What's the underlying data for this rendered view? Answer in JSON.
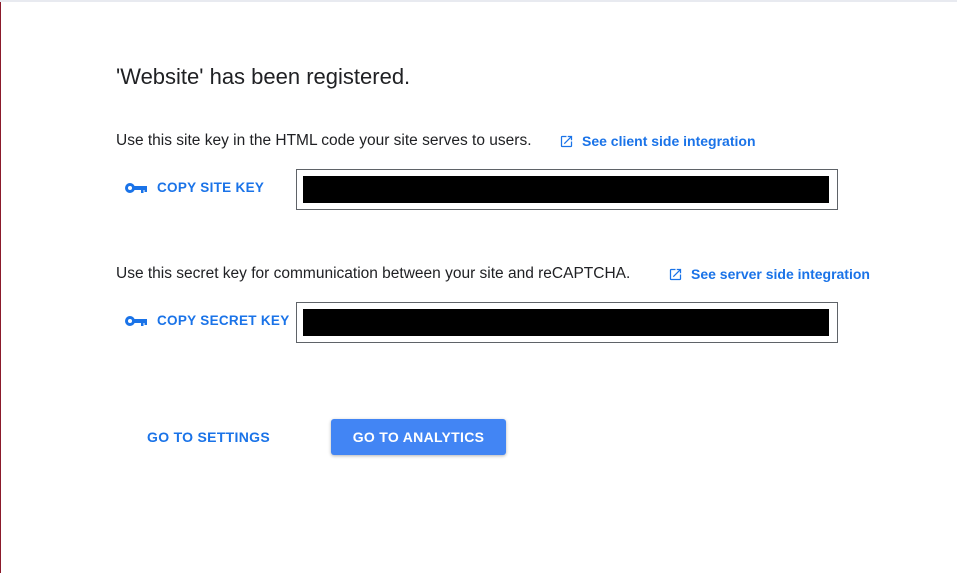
{
  "title": "'Website' has been registered.",
  "site_key": {
    "description": "Use this site key in the HTML code your site serves to users.",
    "integration_link": "See client side integration",
    "copy_label": "COPY SITE KEY",
    "value_redacted": true
  },
  "secret_key": {
    "description": "Use this secret key for communication between your site and reCAPTCHA.",
    "integration_link": "See server side integration",
    "copy_label": "COPY SECRET KEY",
    "value_redacted": true
  },
  "actions": {
    "settings_label": "GO TO SETTINGS",
    "analytics_label": "GO TO ANALYTICS"
  },
  "icons": {
    "key": "key-icon",
    "external_link": "open-in-new-icon"
  },
  "colors": {
    "accent": "#1a73e8",
    "primary_button": "#4285f4",
    "text": "#202124"
  }
}
